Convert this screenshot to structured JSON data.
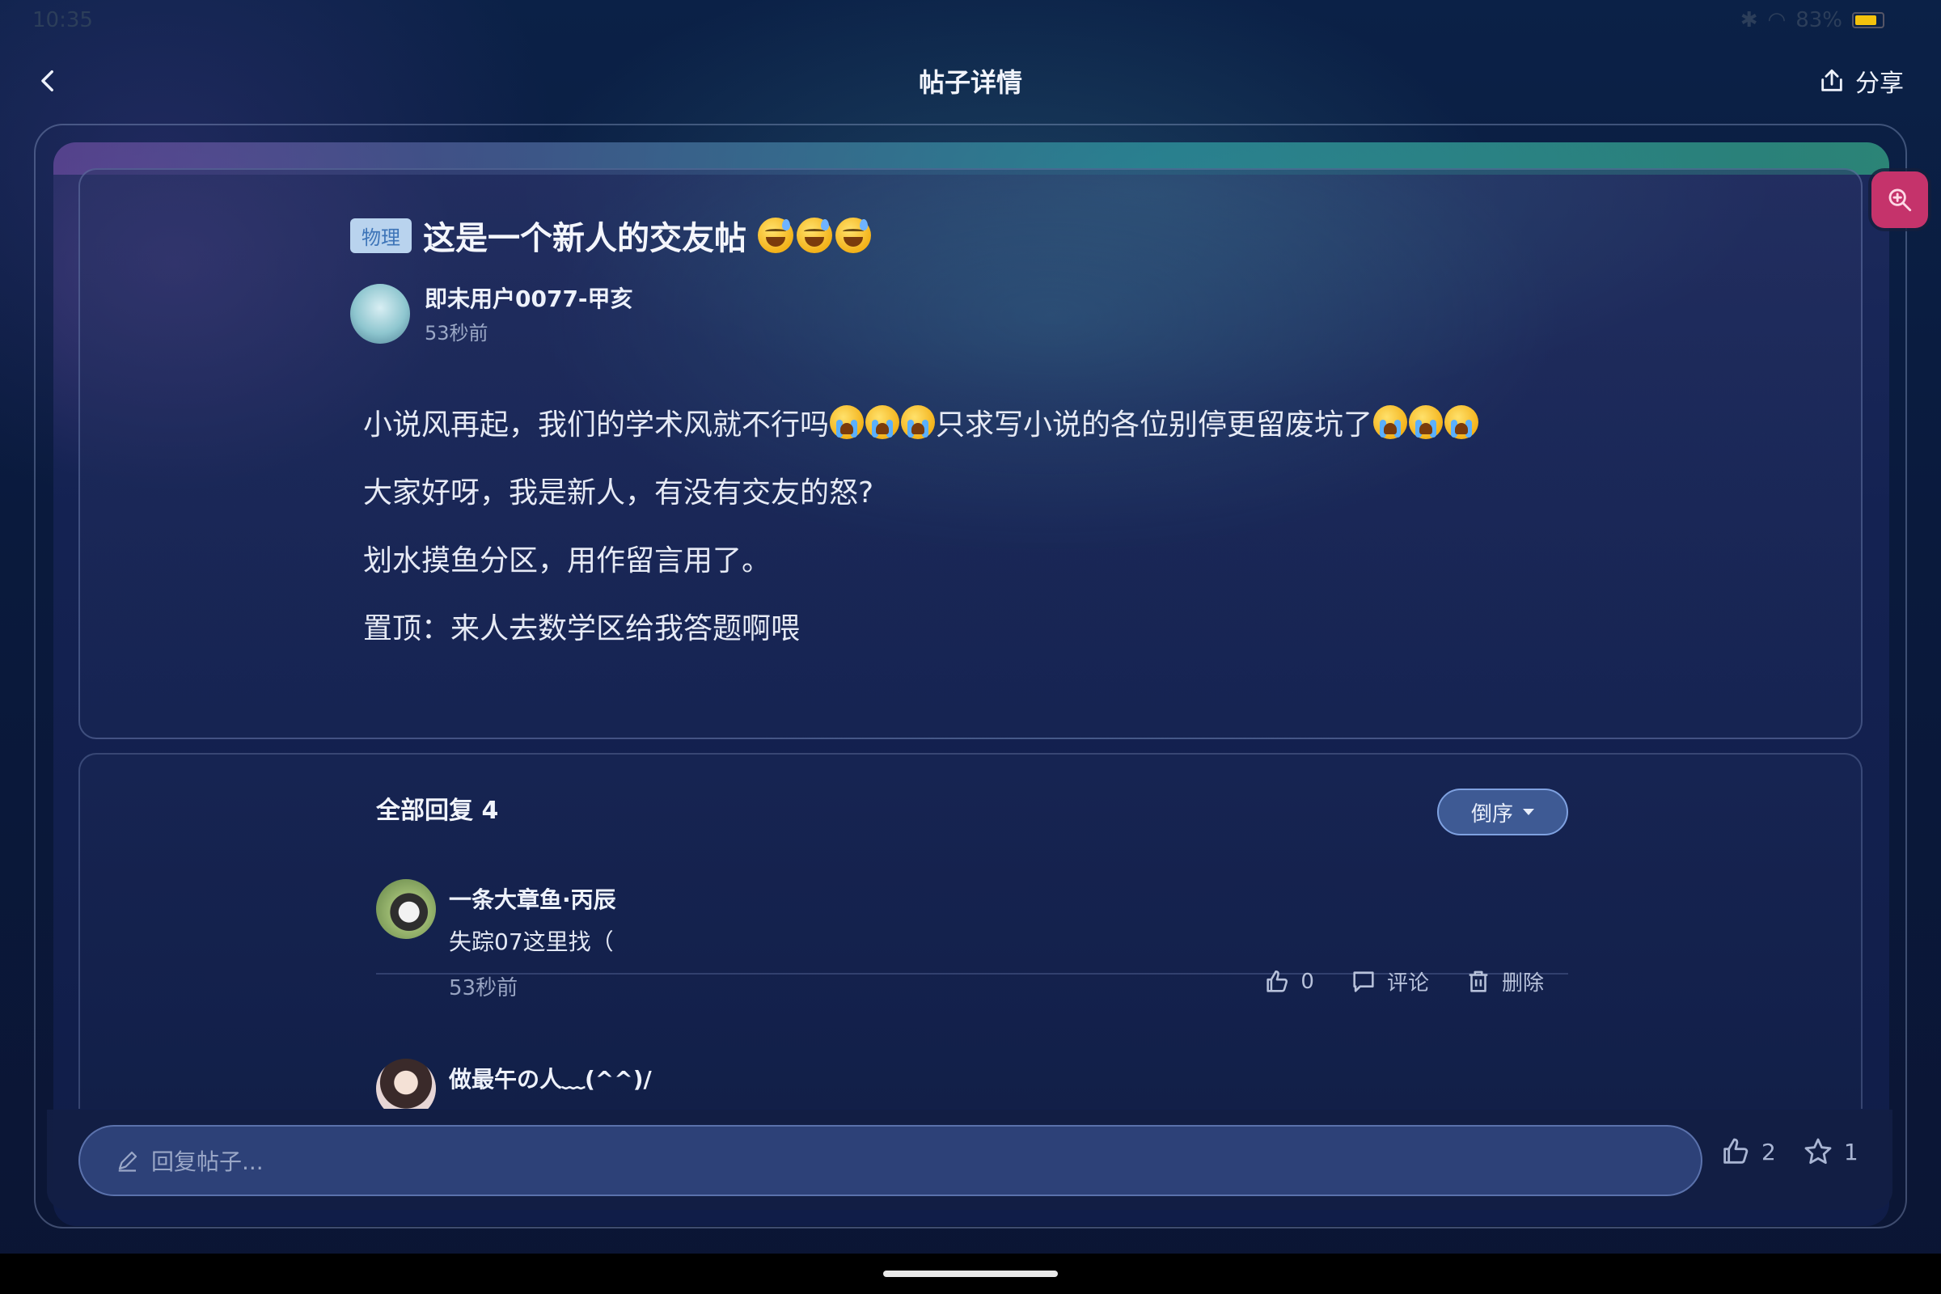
{
  "status_bar": {
    "time": "10:35",
    "battery": "83%"
  },
  "header": {
    "title": "帖子详情",
    "share_label": "分享"
  },
  "post": {
    "tag": "物理",
    "title": "这是一个新人的交友帖",
    "author_name": "即未用户0077-甲亥",
    "time": "53秒前",
    "lines": [
      "小说风再起，我们的学术风就不行吗",
      "只求写小说的各位别停更留废坑了",
      "大家好呀，我是新人，有没有交友的怒?",
      "划水摸鱼分区，用作留言用了。",
      "置顶：来人去数学区给我答题啊喂"
    ]
  },
  "replies": {
    "header": "全部回复 4",
    "sort_label": "倒序",
    "items": [
      {
        "name": "一条大章鱼·丙辰",
        "text": "失踪07这里找（",
        "time": "53秒前",
        "likes": "0",
        "comment_label": "评论",
        "delete_label": "删除"
      },
      {
        "name": "做最午の人﹏(^^)/"
      }
    ]
  },
  "bottom_bar": {
    "placeholder": "回复帖子...",
    "like_count": "2",
    "fav_count": "1"
  },
  "icons": {
    "back": "chevron-left-icon",
    "share": "share-icon",
    "zoom": "zoom-in-icon",
    "like": "thumbs-up-icon",
    "comment": "comment-icon",
    "delete": "trash-icon",
    "pencil": "pencil-icon",
    "star": "star-icon"
  },
  "colors": {
    "accent_zoom": "#c5336b",
    "tag_bg": "#b9d3ee",
    "tag_text": "#3d74b8",
    "sort_bg": "#3e5a94"
  }
}
